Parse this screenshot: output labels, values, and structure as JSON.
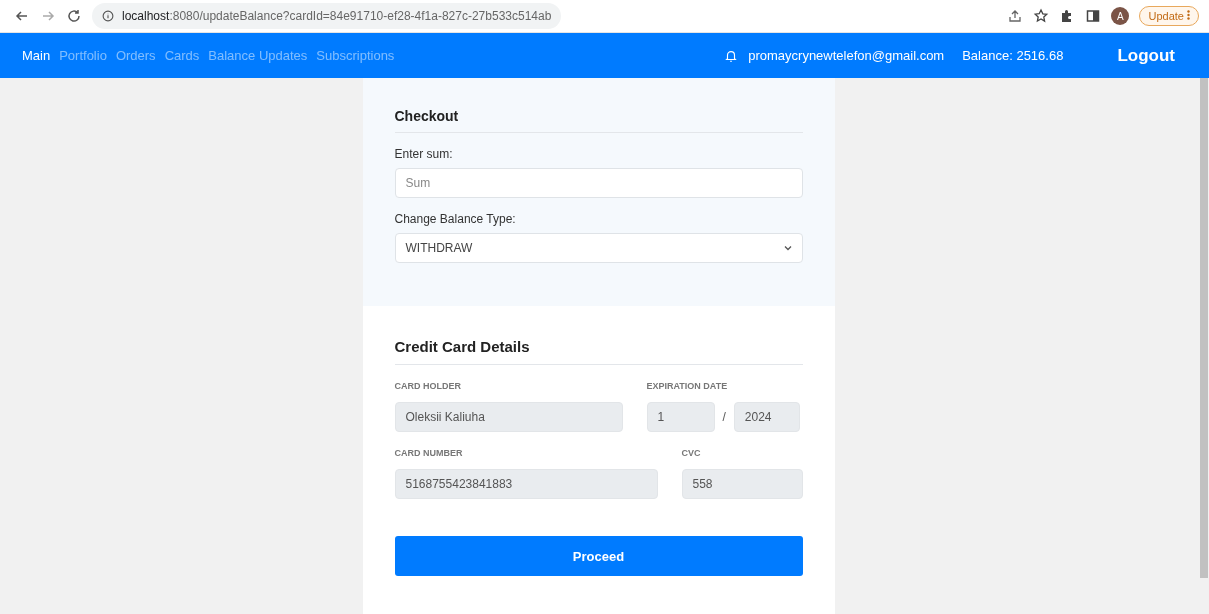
{
  "browser": {
    "url_host": "localhost",
    "url_path": ":8080/updateBalance?cardId=84e91710-ef28-4f1a-827c-27b533c514ab",
    "avatar_letter": "A",
    "update_button": "Update"
  },
  "nav": {
    "items": [
      {
        "label": "Main",
        "selected": true
      },
      {
        "label": "Portfolio",
        "selected": false
      },
      {
        "label": "Orders",
        "selected": false
      },
      {
        "label": "Cards",
        "selected": false
      },
      {
        "label": "Balance Updates",
        "selected": false
      },
      {
        "label": "Subscriptions",
        "selected": false
      }
    ],
    "email": "promaycrynewtelefon@gmail.com",
    "balance": "Balance: 2516.68",
    "logout": "Logout"
  },
  "checkout": {
    "title": "Checkout",
    "sum_label": "Enter sum:",
    "sum_placeholder": "Sum",
    "type_label": "Change Balance Type:",
    "type_value": "WITHDRAW"
  },
  "card_details": {
    "title": "Credit Card Details",
    "holder_label": "CARD HOLDER",
    "holder": "Oleksii Kaliuha",
    "expiration_label": "EXPIRATION DATE",
    "exp_month": "1",
    "exp_separator": "/",
    "exp_year": "2024",
    "number_label": "CARD NUMBER",
    "number": "5168755423841883",
    "cvc_label": "CVC",
    "cvc": "558"
  },
  "proceed_button": "Proceed"
}
